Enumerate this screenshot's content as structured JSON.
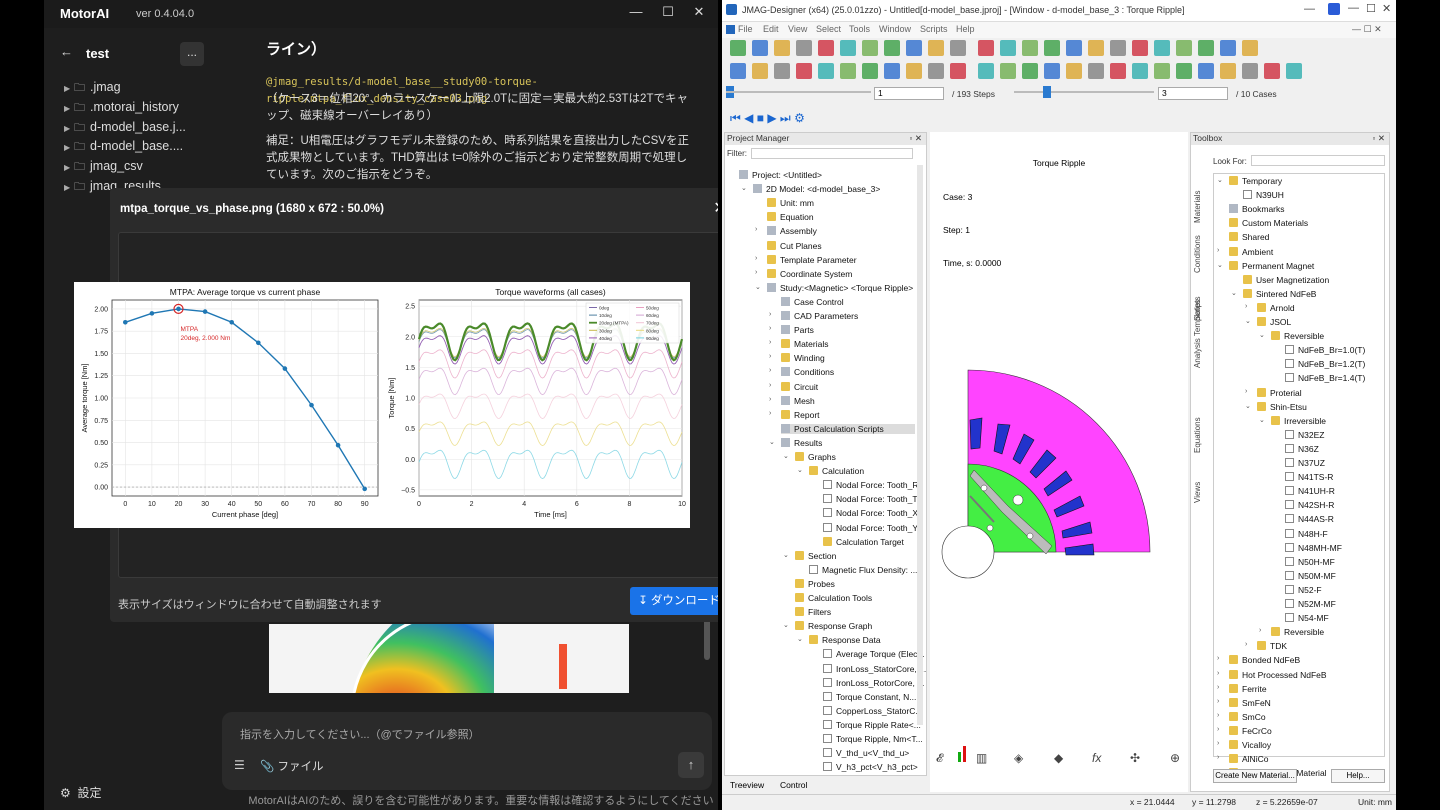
{
  "motorai": {
    "logo": "MotorAI",
    "version": "ver 0.4.04.0",
    "window_controls": [
      "—",
      "☐",
      "✕"
    ],
    "project": "test",
    "more": "...",
    "files": [
      ".jmag",
      ".motorai_history",
      "d-model_base.j...",
      "d-model_base....",
      "jmag_csv",
      "jmag_results"
    ],
    "chat": {
      "heading": "ライン）",
      "code": "@jmag_results/d-model_base__study00-torque-ripple/mtpa_flux_density_case03.png",
      "p1": "（ケース3＝位相20°、カラースケール上限2.0Tに固定＝実最大約2.53Tは2Tでキャップ、磁束線オーバーレイあり）",
      "p2": "補足：U相電圧はグラフモデル未登録のため、時系列結果を直接出力したCSVを正式成果物としています。THD算出は t=0除外のご指示どおり定常整数周期で処理しています。次のご指示をどうぞ。"
    },
    "modal": {
      "title": "mtpa_torque_vs_phase.png (1680 x 672 : 50.0%)",
      "note": "表示サイズはウィンドウに合わせて自動調整されます",
      "download": "ダウンロード"
    },
    "input": {
      "placeholder": "指示を入力してください...（@でファイル参照）",
      "file": "ファイル"
    },
    "settings": "設定",
    "footer": "MotorAIはAIのため、誤りを含む可能性があります。重要な情報は確認するようにしてください"
  },
  "chart_data": [
    {
      "type": "line",
      "title": "MTPA: Average torque vs current phase",
      "xlabel": "Current phase [deg]",
      "ylabel": "Average torque [Nm]",
      "xlim": [
        -5,
        95
      ],
      "ylim": [
        -0.1,
        2.1
      ],
      "xticks": [
        0,
        10,
        20,
        30,
        40,
        50,
        60,
        70,
        80,
        90
      ],
      "yticks": [
        0.0,
        0.25,
        0.5,
        0.75,
        1.0,
        1.25,
        1.5,
        1.75,
        2.0
      ],
      "ytick_labels": [
        "0.00",
        "0.25",
        "0.50",
        "0.75",
        "1.00",
        "1.25",
        "1.50",
        "1.75",
        "2.00"
      ],
      "x": [
        0,
        10,
        20,
        30,
        40,
        50,
        60,
        70,
        80,
        90
      ],
      "y": [
        1.85,
        1.95,
        2.0,
        1.97,
        1.85,
        1.62,
        1.33,
        0.92,
        0.47,
        -0.02
      ],
      "annotation": {
        "text": "MTPA",
        "text2": "20deg, 2.000 Nm",
        "x": 20,
        "y": 2.0
      },
      "grid": true
    },
    {
      "type": "line",
      "title": "Torque waveforms (all cases)",
      "xlabel": "Time [ms]",
      "ylabel": "Torque [Nm]",
      "xlim": [
        0,
        10
      ],
      "ylim": [
        -0.6,
        2.6
      ],
      "xticks": [
        0,
        2,
        4,
        6,
        8,
        10
      ],
      "yticks": [
        -0.5,
        0.0,
        0.5,
        1.0,
        1.5,
        2.0,
        2.5
      ],
      "ytick_labels": [
        "−0.5",
        "0.0",
        "0.5",
        "1.0",
        "1.5",
        "2.0",
        "2.5"
      ],
      "legend_position": "top-right",
      "series": [
        {
          "name": "0deg",
          "mean": 1.85,
          "amp": 0.3,
          "color": "#7b68a8"
        },
        {
          "name": "10deg",
          "mean": 1.95,
          "amp": 0.3,
          "color": "#4e7fa0"
        },
        {
          "name": "20deg (MTPA)",
          "mean": 2.0,
          "amp": 0.35,
          "color": "#4a8a2a",
          "bold": true
        },
        {
          "name": "30deg",
          "mean": 1.97,
          "amp": 0.3,
          "color": "#c6b84a"
        },
        {
          "name": "40deg",
          "mean": 1.85,
          "amp": 0.3,
          "color": "#9b59b6"
        },
        {
          "name": "50deg",
          "mean": 1.62,
          "amp": 0.3,
          "color": "#e8a0c0"
        },
        {
          "name": "60deg",
          "mean": 1.33,
          "amp": 0.28,
          "color": "#d2a2d2"
        },
        {
          "name": "70deg",
          "mean": 0.92,
          "amp": 0.26,
          "color": "#f2c5d5"
        },
        {
          "name": "80deg",
          "mean": 0.47,
          "amp": 0.25,
          "color": "#e8d878"
        },
        {
          "name": "90deg",
          "mean": -0.02,
          "amp": 0.3,
          "color": "#70d0e0"
        }
      ],
      "grid": true
    }
  ],
  "jmag": {
    "title": "JMAG-Designer (x64) (25.0.01zzo) - Untitled[d-model_base.jproj] - [Window - d-model_base_3 : Torque Ripple]",
    "menus": [
      "File",
      "Edit",
      "View",
      "Select",
      "Tools",
      "Window",
      "Scripts",
      "Help"
    ],
    "step_value": "1",
    "step_total": "/ 193 Steps",
    "case_value": "3",
    "case_total": "/ 10 Cases",
    "project_manager": "Project Manager",
    "filter": "Filter:",
    "tree": [
      {
        "d": 0,
        "t": "Project: <Untitled>",
        "i": "gi"
      },
      {
        "d": 1,
        "t": "2D Model: <d-model_base_3>",
        "i": "gi",
        "tog": "⌄"
      },
      {
        "d": 2,
        "t": "Unit: mm",
        "i": "fi"
      },
      {
        "d": 2,
        "t": "Equation",
        "i": "fi"
      },
      {
        "d": 2,
        "t": "Assembly",
        "i": "gi",
        "tog": "›"
      },
      {
        "d": 2,
        "t": "Cut Planes",
        "i": "fi"
      },
      {
        "d": 2,
        "t": "Template Parameter",
        "i": "fi",
        "tog": "›"
      },
      {
        "d": 2,
        "t": "Coordinate System",
        "i": "fi",
        "tog": "›"
      },
      {
        "d": 2,
        "t": "Study:<Magnetic> <Torque Ripple>",
        "i": "gi",
        "tog": "⌄"
      },
      {
        "d": 3,
        "t": "Case Control",
        "i": "gi"
      },
      {
        "d": 3,
        "t": "CAD Parameters",
        "i": "gi",
        "tog": "›"
      },
      {
        "d": 3,
        "t": "Parts",
        "i": "gi",
        "tog": "›"
      },
      {
        "d": 3,
        "t": "Materials",
        "i": "fi",
        "tog": "›"
      },
      {
        "d": 3,
        "t": "Winding",
        "i": "fi",
        "tog": "›"
      },
      {
        "d": 3,
        "t": "Conditions",
        "i": "gi",
        "tog": "›"
      },
      {
        "d": 3,
        "t": "Circuit",
        "i": "fi",
        "tog": "›"
      },
      {
        "d": 3,
        "t": "Mesh",
        "i": "gi",
        "tog": "›"
      },
      {
        "d": 3,
        "t": "Report",
        "i": "fi",
        "tog": "›"
      },
      {
        "d": 3,
        "t": "Post Calculation Scripts",
        "i": "gi",
        "sel": true
      },
      {
        "d": 3,
        "t": "Results",
        "i": "gi",
        "tog": "⌄"
      },
      {
        "d": 4,
        "t": "Graphs",
        "i": "fi",
        "tog": "⌄"
      },
      {
        "d": 5,
        "t": "Calculation",
        "i": "fi",
        "tog": "⌄"
      },
      {
        "d": 6,
        "t": "Nodal Force: Tooth_R",
        "i": "di"
      },
      {
        "d": 6,
        "t": "Nodal Force: Tooth_T",
        "i": "di"
      },
      {
        "d": 6,
        "t": "Nodal Force: Tooth_X",
        "i": "di"
      },
      {
        "d": 6,
        "t": "Nodal Force: Tooth_Y",
        "i": "di"
      },
      {
        "d": 6,
        "t": "Calculation Target",
        "i": "fi"
      },
      {
        "d": 4,
        "t": "Section",
        "i": "fi",
        "tog": "⌄"
      },
      {
        "d": 5,
        "t": "Magnetic Flux Density: ...",
        "i": "di"
      },
      {
        "d": 4,
        "t": "Probes",
        "i": "fi"
      },
      {
        "d": 4,
        "t": "Calculation Tools",
        "i": "fi"
      },
      {
        "d": 4,
        "t": "Filters",
        "i": "fi"
      },
      {
        "d": 4,
        "t": "Response Graph",
        "i": "fi",
        "tog": "⌄"
      },
      {
        "d": 5,
        "t": "Response Data",
        "i": "fi",
        "tog": "⌄"
      },
      {
        "d": 6,
        "t": "Average Torque (Elec...",
        "i": "di"
      },
      {
        "d": 6,
        "t": "IronLoss_StatorCore, ...",
        "i": "di"
      },
      {
        "d": 6,
        "t": "IronLoss_RotorCore, ...",
        "i": "di"
      },
      {
        "d": 6,
        "t": "Torque Constant, N...",
        "i": "di"
      },
      {
        "d": 6,
        "t": "CopperLoss_StatorC...",
        "i": "di"
      },
      {
        "d": 6,
        "t": "Torque Ripple Rate<...",
        "i": "di"
      },
      {
        "d": 6,
        "t": "Torque Ripple, Nm<T...",
        "i": "di"
      },
      {
        "d": 6,
        "t": "V_thd_u<V_thd_u>",
        "i": "di"
      },
      {
        "d": 6,
        "t": "V_h3_pct<V_h3_pct>",
        "i": "di"
      }
    ],
    "viewport": {
      "title": "Torque Ripple",
      "case": "Case: 3",
      "step": "Step: 1",
      "time": "Time, s: 0.0000"
    },
    "toolbox": "Toolbox",
    "lookfor": "Look For:",
    "vtabs": [
      "Materials",
      "Conditions",
      "Scripts",
      "Analysis Templates",
      "Equations",
      "Views"
    ],
    "mat_tree": [
      {
        "d": 0,
        "t": "Temporary",
        "tog": "⌄"
      },
      {
        "d": 1,
        "t": "N39UH",
        "i": "di"
      },
      {
        "d": 0,
        "t": "Bookmarks",
        "i": "gi"
      },
      {
        "d": 0,
        "t": "Custom Materials"
      },
      {
        "d": 0,
        "t": "Shared"
      },
      {
        "d": 0,
        "t": "Ambient",
        "tog": "›"
      },
      {
        "d": 0,
        "t": "Permanent Magnet",
        "tog": "⌄"
      },
      {
        "d": 1,
        "t": "User Magnetization"
      },
      {
        "d": 1,
        "t": "Sintered NdFeB",
        "tog": "⌄"
      },
      {
        "d": 2,
        "t": "Arnold",
        "tog": "›"
      },
      {
        "d": 2,
        "t": "JSOL",
        "tog": "⌄"
      },
      {
        "d": 3,
        "t": "Reversible",
        "tog": "⌄"
      },
      {
        "d": 4,
        "t": "NdFeB_Br=1.0(T)",
        "i": "di"
      },
      {
        "d": 4,
        "t": "NdFeB_Br=1.2(T)",
        "i": "di"
      },
      {
        "d": 4,
        "t": "NdFeB_Br=1.4(T)",
        "i": "di"
      },
      {
        "d": 2,
        "t": "Proterial",
        "tog": "›"
      },
      {
        "d": 2,
        "t": "Shin-Etsu",
        "tog": "⌄"
      },
      {
        "d": 3,
        "t": "Irreversible",
        "tog": "⌄"
      },
      {
        "d": 4,
        "t": "N32EZ",
        "i": "di"
      },
      {
        "d": 4,
        "t": "N36Z",
        "i": "di"
      },
      {
        "d": 4,
        "t": "N37UZ",
        "i": "di"
      },
      {
        "d": 4,
        "t": "N41TS-R",
        "i": "di"
      },
      {
        "d": 4,
        "t": "N41UH-R",
        "i": "di"
      },
      {
        "d": 4,
        "t": "N42SH-R",
        "i": "di"
      },
      {
        "d": 4,
        "t": "N44AS-R",
        "i": "di"
      },
      {
        "d": 4,
        "t": "N48H-F",
        "i": "di"
      },
      {
        "d": 4,
        "t": "N48MH-MF",
        "i": "di"
      },
      {
        "d": 4,
        "t": "N50H-MF",
        "i": "di"
      },
      {
        "d": 4,
        "t": "N50M-MF",
        "i": "di"
      },
      {
        "d": 4,
        "t": "N52-F",
        "i": "di"
      },
      {
        "d": 4,
        "t": "N52M-MF",
        "i": "di"
      },
      {
        "d": 4,
        "t": "N54-MF",
        "i": "di"
      },
      {
        "d": 3,
        "t": "Reversible",
        "tog": "›"
      },
      {
        "d": 2,
        "t": "TDK",
        "tog": "›"
      },
      {
        "d": 0,
        "t": "Bonded NdFeB",
        "tog": "›"
      },
      {
        "d": 0,
        "t": "Hot Processed NdFeB",
        "tog": "›"
      },
      {
        "d": 0,
        "t": "Ferrite",
        "tog": "›"
      },
      {
        "d": 0,
        "t": "SmFeN",
        "tog": "›"
      },
      {
        "d": 0,
        "t": "SmCo",
        "tog": "›"
      },
      {
        "d": 0,
        "t": "FeCrCo",
        "tog": "›"
      },
      {
        "d": 0,
        "t": "Vicalloy",
        "tog": "›"
      },
      {
        "d": 0,
        "t": "AlNiCo",
        "tog": "›"
      },
      {
        "d": 0,
        "t": "Soft Magnetic Material",
        "tog": "⌄"
      }
    ],
    "create_material": "Create New Material...",
    "help": "Help...",
    "bottom_tabs": [
      "Treeview",
      "Control"
    ],
    "status": {
      "x": "x = 21.0444",
      "y": "y = 11.2798",
      "z": "z = 5.22659e-07",
      "unit": "Unit: mm"
    }
  }
}
